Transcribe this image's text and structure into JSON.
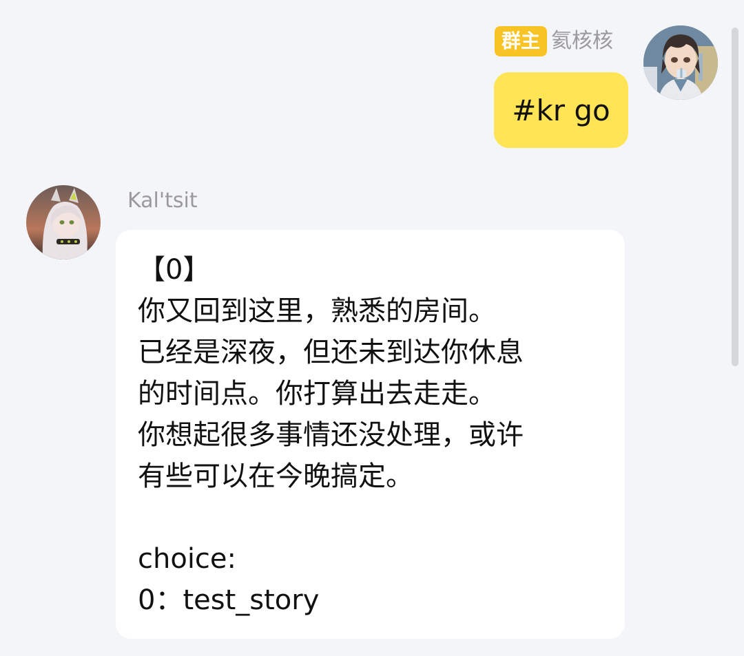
{
  "outgoing_message": {
    "role_badge": "群主",
    "sender_name": "氦核核",
    "text": "#kr go",
    "avatar_icon": "anime-girl-avatar"
  },
  "incoming_message": {
    "sender_name": "Kal'tsit",
    "avatar_icon": "kaltsit-avatar",
    "lines": [
      "【0】",
      "你又回到这里，熟悉的房间。",
      "已经是深夜，但还未到达你休息",
      "的时间点。你打算出去走走。",
      "你想起很多事情还没处理，或许",
      "有些可以在今晚搞定。",
      "",
      "choice:",
      "0：test_story"
    ]
  },
  "colors": {
    "background": "#f4f5f9",
    "outgoing_bubble": "#ffe455",
    "incoming_bubble": "#ffffff",
    "role_badge": "#f7c325",
    "sender_name": "#9a9a9a"
  }
}
